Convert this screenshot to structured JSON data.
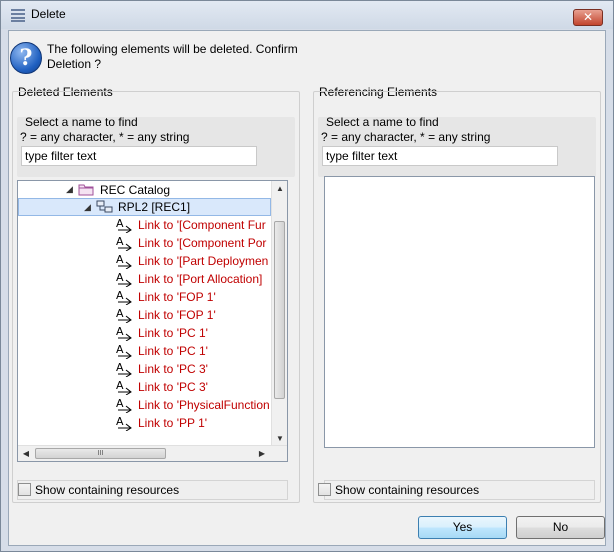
{
  "window": {
    "title": "Delete",
    "close_label": "✕"
  },
  "message": {
    "icon": "question-icon",
    "text": "The following elements will be deleted. Confirm Deletion ?"
  },
  "deleted_panel": {
    "label": "Deleted Elements",
    "filter_hint_1": "Select a name to find",
    "filter_hint_2": "? = any character, * = any string",
    "filter_value": "type filter text",
    "tree": [
      {
        "label": "REC Catalog",
        "icon": "folder-icon",
        "expanded": true
      },
      {
        "label": "RPL2 [REC1]",
        "icon": "replica-icon",
        "expanded": true,
        "selected": true
      },
      {
        "label": "Link to '[Component Fur",
        "icon": "link-icon"
      },
      {
        "label": "Link to '[Component Por",
        "icon": "link-icon"
      },
      {
        "label": "Link to '[Part Deploymen",
        "icon": "link-icon"
      },
      {
        "label": "Link to '[Port Allocation]",
        "icon": "link-icon"
      },
      {
        "label": "Link to 'FOP 1'",
        "icon": "link-icon"
      },
      {
        "label": "Link to 'FOP 1'",
        "icon": "link-icon"
      },
      {
        "label": "Link to 'PC 1'",
        "icon": "link-icon"
      },
      {
        "label": "Link to 'PC 1'",
        "icon": "link-icon"
      },
      {
        "label": "Link to 'PC 3'",
        "icon": "link-icon"
      },
      {
        "label": "Link to 'PC 3'",
        "icon": "link-icon"
      },
      {
        "label": "Link to 'PhysicalFunction",
        "icon": "link-icon"
      },
      {
        "label": "Link to 'PP 1'",
        "icon": "link-icon"
      }
    ],
    "scroll_grip": "III",
    "show_resources_label": "Show containing resources"
  },
  "referencing_panel": {
    "label": "Referencing Elements",
    "filter_hint_1": "Select a name to find",
    "filter_hint_2": "? = any character, * = any string",
    "filter_value": "type filter text",
    "show_resources_label": "Show containing resources"
  },
  "buttons": {
    "yes": "Yes",
    "no": "No"
  },
  "colors": {
    "link_text": "#c00000",
    "selection": "#d9e8fb"
  }
}
